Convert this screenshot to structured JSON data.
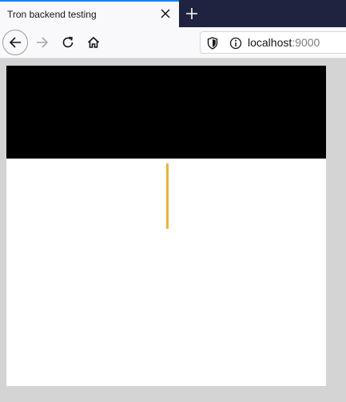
{
  "browser": {
    "tab": {
      "title": "Tron backend testing"
    },
    "address_bar": {
      "host": "localhost",
      "port": ":9000"
    },
    "icons": {
      "tab_close": "close-icon",
      "new_tab": "plus-icon",
      "back": "back-arrow-icon",
      "forward": "forward-arrow-icon",
      "reload": "reload-icon",
      "home": "home-icon",
      "shield": "shield-icon",
      "info": "info-icon"
    }
  },
  "colors": {
    "tab_accent": "#0a84ff",
    "tabbar_bg": "#202340",
    "viewport_bg": "#d4d4d4",
    "panel": "#000000",
    "bar": "#e8b43c"
  }
}
